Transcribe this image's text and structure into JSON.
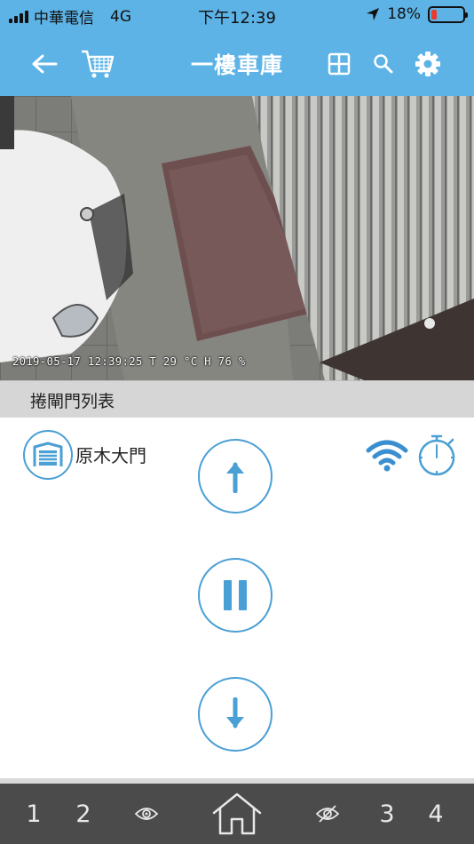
{
  "status_bar": {
    "carrier": "中華電信",
    "network": "4G",
    "time": "下午12:39",
    "battery_percent": "18%",
    "battery_level": 0.18,
    "battery_color": "#e63b2e"
  },
  "nav": {
    "title": "一樓車庫",
    "icons": [
      "back-arrow-icon",
      "cart-icon",
      "grid-icon",
      "search-icon",
      "gear-icon"
    ],
    "background": "#5db3e6"
  },
  "camera": {
    "overlay_text": "2019-05-17 12:39:25   T 29 °C  H 76 %"
  },
  "section": {
    "title": "捲閘門列表"
  },
  "door": {
    "name": "原木大門",
    "icons": [
      "garage-door-icon",
      "wifi-icon",
      "timer-icon"
    ]
  },
  "controls": {
    "icons": [
      "up-arrow-icon",
      "pause-icon",
      "down-arrow-icon"
    ],
    "accent": "#4a9fd4"
  },
  "bottom_nav": {
    "tab_1": "1",
    "tab_2": "2",
    "tab_3": "3",
    "tab_4": "4",
    "icons": [
      "eye-icon",
      "home-icon",
      "eye-off-icon"
    ]
  }
}
